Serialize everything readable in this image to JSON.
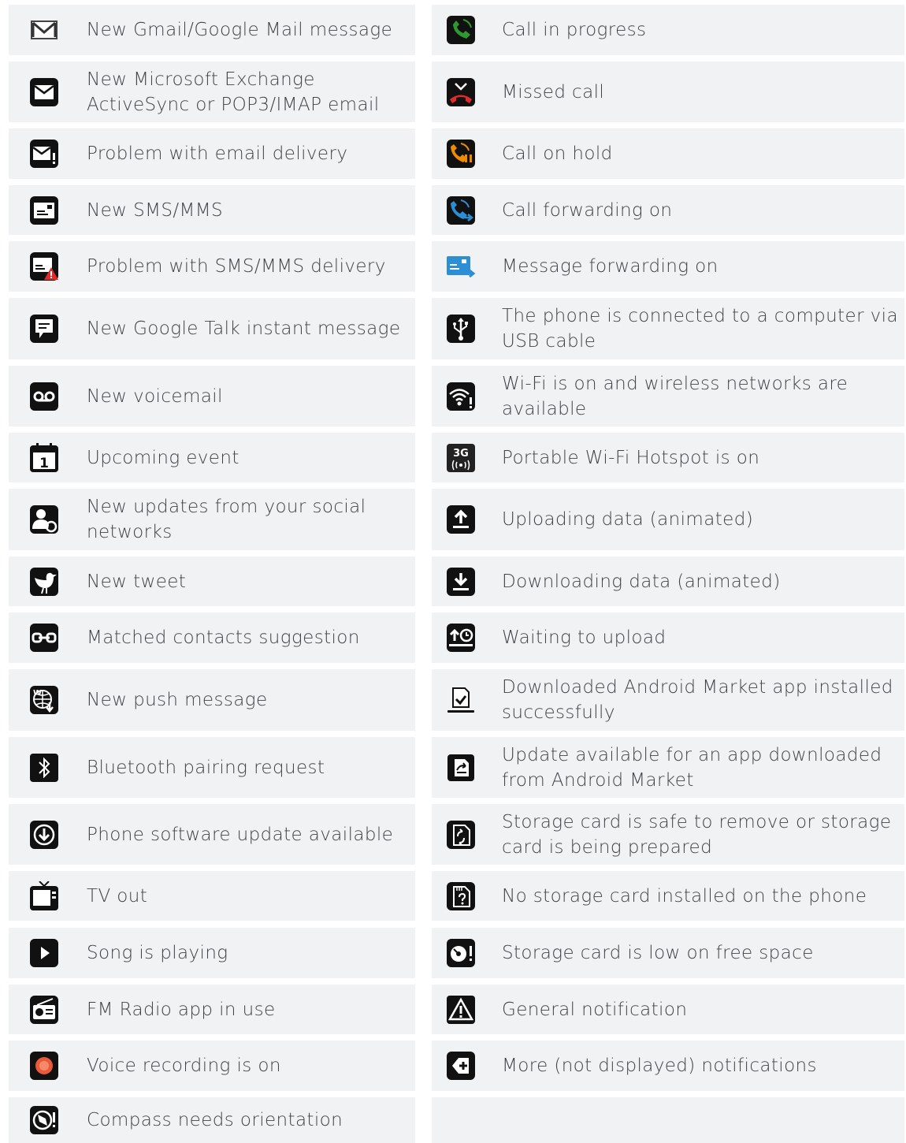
{
  "left": [
    {
      "icon": "gmail-icon",
      "label": "New Gmail/Google Mail message"
    },
    {
      "icon": "email-icon",
      "label": "New Microsoft Exchange ActiveSync or POP3/IMAP email"
    },
    {
      "icon": "email-problem-icon",
      "label": "Problem with email delivery"
    },
    {
      "icon": "sms-icon",
      "label": "New SMS/MMS"
    },
    {
      "icon": "sms-problem-icon",
      "label": "Problem with SMS/MMS delivery"
    },
    {
      "icon": "google-talk-icon",
      "label": "New Google Talk instant message"
    },
    {
      "icon": "voicemail-icon",
      "label": "New voicemail"
    },
    {
      "icon": "calendar-event-icon",
      "label": "Upcoming event"
    },
    {
      "icon": "social-update-icon",
      "label": "New updates from your social networks"
    },
    {
      "icon": "tweet-bird-icon",
      "label": "New tweet"
    },
    {
      "icon": "matched-contacts-icon",
      "label": "Matched contacts suggestion"
    },
    {
      "icon": "push-message-icon",
      "label": "New push message"
    },
    {
      "icon": "bluetooth-icon",
      "label": "Bluetooth pairing request"
    },
    {
      "icon": "software-update-icon",
      "label": "Phone software update available"
    },
    {
      "icon": "tv-out-icon",
      "label": "TV out"
    },
    {
      "icon": "play-icon",
      "label": "Song is playing"
    },
    {
      "icon": "fm-radio-icon",
      "label": "FM Radio app in use"
    },
    {
      "icon": "voice-recording-icon",
      "label": "Voice recording is on"
    },
    {
      "icon": "compass-icon",
      "label": "Compass needs orientation"
    }
  ],
  "right": [
    {
      "icon": "call-in-progress-icon",
      "label": "Call in progress"
    },
    {
      "icon": "missed-call-icon",
      "label": "Missed call"
    },
    {
      "icon": "call-on-hold-icon",
      "label": "Call on hold"
    },
    {
      "icon": "call-forwarding-icon",
      "label": "Call forwarding on"
    },
    {
      "icon": "message-forwarding-icon",
      "label": "Message forwarding on"
    },
    {
      "icon": "usb-icon",
      "label": "The phone is connected to a computer via USB cable"
    },
    {
      "icon": "wifi-icon",
      "label": "Wi-Fi is on and wireless networks are available"
    },
    {
      "icon": "hotspot-3g-icon",
      "label": "Portable Wi-Fi Hotspot is on",
      "badge": "3G"
    },
    {
      "icon": "upload-icon",
      "label": "Uploading data (animated)"
    },
    {
      "icon": "download-icon",
      "label": "Downloading data (animated)"
    },
    {
      "icon": "waiting-upload-icon",
      "label": "Waiting to upload"
    },
    {
      "icon": "app-installed-icon",
      "label": "Downloaded Android Market app installed successfully"
    },
    {
      "icon": "app-update-icon",
      "label": "Update available for an app downloaded from Android Market"
    },
    {
      "icon": "storage-safe-icon",
      "label": "Storage card is safe to remove or storage card is being prepared"
    },
    {
      "icon": "no-storage-icon",
      "label": "No storage card installed on the phone"
    },
    {
      "icon": "storage-low-icon",
      "label": "Storage card is low on free space"
    },
    {
      "icon": "general-notification-icon",
      "label": "General notification"
    },
    {
      "icon": "more-notifications-icon",
      "label": "More (not displayed) notifications"
    }
  ],
  "colors": {
    "row_background": "#f1f2f3",
    "text": "#404448",
    "icon_dark": "#111111",
    "call_green": "#2e9a2e",
    "missed_red": "#e32a2a",
    "hold_orange": "#f08a00",
    "forward_blue": "#2c8fd6",
    "recording_red": "#e85a3a"
  }
}
